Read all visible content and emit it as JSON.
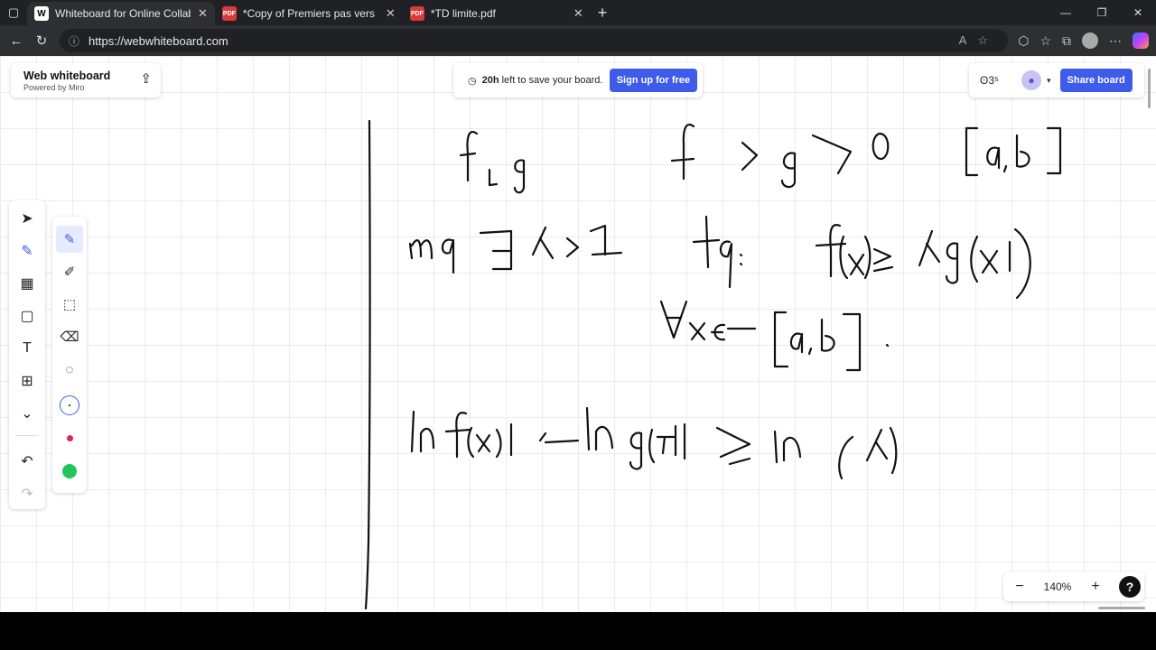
{
  "browser": {
    "tabs": [
      {
        "title": "Whiteboard for Online Collaborati",
        "icon": "W",
        "active": true
      },
      {
        "title": "*Copy of Premiers pas vers les ma",
        "icon": "PDF",
        "active": false
      },
      {
        "title": "*TD limite.pdf",
        "icon": "PDF",
        "active": false
      }
    ],
    "url": "https://webwhiteboard.com"
  },
  "app": {
    "brand_title": "Web whiteboard",
    "brand_sub": "Powered by Miro",
    "save_hours": "20h",
    "save_text": "left to save your board.",
    "signup_label": "Sign up for free",
    "reactions_label": "ʘ3⁵",
    "share_label": "Share board",
    "zoom": "140%",
    "help_label": "?"
  },
  "colors": {
    "accent": "#3e5bea",
    "swatch_red": "#e0264a",
    "swatch_green": "#22c45e",
    "ink": "#111111"
  },
  "tools": [
    "select-icon",
    "pen-icon",
    "templates-icon",
    "sticky-note-icon",
    "text-icon",
    "shapes-icon",
    "more-icon",
    "undo-icon",
    "redo-icon"
  ],
  "pen_tools": [
    "pen-icon",
    "highlighter-icon",
    "smart-draw-icon",
    "eraser-icon",
    "lasso-icon"
  ],
  "handwriting": {
    "line1": "f, g    f > g > 0   [a,b]",
    "line2": "mq ∃ λ > 1   tq:  f(x) ≥ λ g(x)",
    "line3": "∀x ∈ [a,b] .",
    "line4": "ln f(x) − ln g(x) ≥ ln(λ)"
  }
}
